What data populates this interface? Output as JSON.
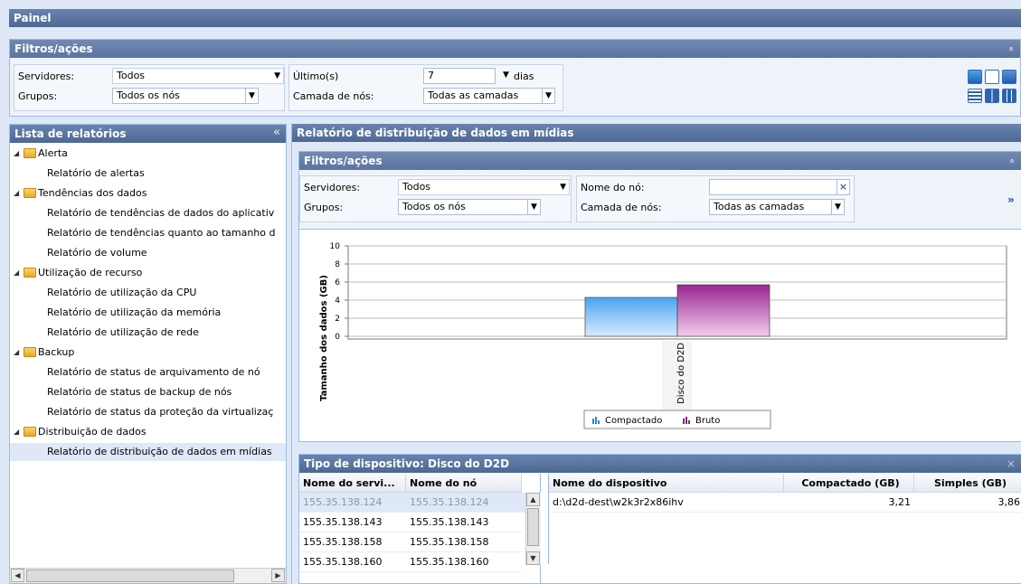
{
  "header": {
    "title": "Painel"
  },
  "top_filters": {
    "title": "Filtros/ações",
    "collapse_glyph": "»",
    "servers_label": "Servidores:",
    "servers_value": "Todos",
    "groups_label": "Grupos:",
    "groups_value": "Todos os nós",
    "last_label": "Último(s)",
    "last_value": "7",
    "last_unit": "dias",
    "tier_label": "Camada de nós:",
    "tier_value": "Todas as camadas"
  },
  "toolbar_icons": [
    "refresh-icon",
    "email-icon",
    "export-icon",
    "single-column-icon",
    "two-column-icon",
    "three-column-icon"
  ],
  "report_list": {
    "title": "Lista de relatórios",
    "collapse_glyph": "«",
    "categories": [
      {
        "label": "Alerta",
        "items": [
          "Relatório de alertas"
        ]
      },
      {
        "label": "Tendências dos dados",
        "items": [
          "Relatório de tendências de dados do aplicativ",
          "Relatório de tendências quanto ao tamanho d",
          "Relatório de volume"
        ]
      },
      {
        "label": "Utilização de recurso",
        "items": [
          "Relatório de utilização da CPU",
          "Relatório de utilização da memória",
          "Relatório de utilização de rede"
        ]
      },
      {
        "label": "Backup",
        "items": [
          "Relatório de status de arquivamento de nó",
          "Relatório de status de backup de nós",
          "Relatório de status da proteção da virtualizaç"
        ]
      },
      {
        "label": "Distribuição de dados",
        "items": [
          "Relatório de distribuição de dados em mídias"
        ]
      }
    ]
  },
  "report": {
    "title": "Relatório de distribuição de dados em mídias",
    "filters": {
      "title": "Filtros/ações",
      "collapse_glyph": "»",
      "servers_label": "Servidores:",
      "servers_value": "Todos",
      "groups_label": "Grupos:",
      "groups_value": "Todos os nós",
      "node_name_label": "Nome do nó:",
      "node_name_value": "",
      "clear_glyph": "×",
      "tier_label": "Camada de nós:",
      "tier_value": "Todas as camadas",
      "expand_glyph": "»"
    }
  },
  "chart_data": {
    "type": "bar",
    "categories": [
      "Disco do D2D"
    ],
    "series": [
      {
        "name": "Compactado",
        "values": [
          4.3
        ],
        "color": "#4aa3f0"
      },
      {
        "name": "Bruto",
        "values": [
          5.7
        ],
        "color": "#9a2593"
      }
    ],
    "ylabel": "Tamanho dos dados (GB)",
    "ylim": [
      0,
      10
    ],
    "yticks": [
      "0",
      "2",
      "4",
      "6",
      "8",
      "10"
    ],
    "grid": true,
    "legend_position": "bottom"
  },
  "detail": {
    "title": "Tipo de dispositivo: Disco do D2D",
    "close_glyph": "×",
    "left_columns": [
      "Nome do servi...",
      "Nome do nó"
    ],
    "left_rows": [
      [
        "155.35.138.124",
        "155.35.138.124"
      ],
      [
        "155.35.138.143",
        "155.35.138.143"
      ],
      [
        "155.35.138.158",
        "155.35.138.158"
      ],
      [
        "155.35.138.160",
        "155.35.138.160"
      ]
    ],
    "right_columns": [
      "Nome do dispositivo",
      "Compactado (GB)",
      "Simples (GB)"
    ],
    "right_rows": [
      [
        "d:\\d2d-dest\\w2k3r2x86ihv",
        "3,21",
        "3,86"
      ]
    ]
  }
}
